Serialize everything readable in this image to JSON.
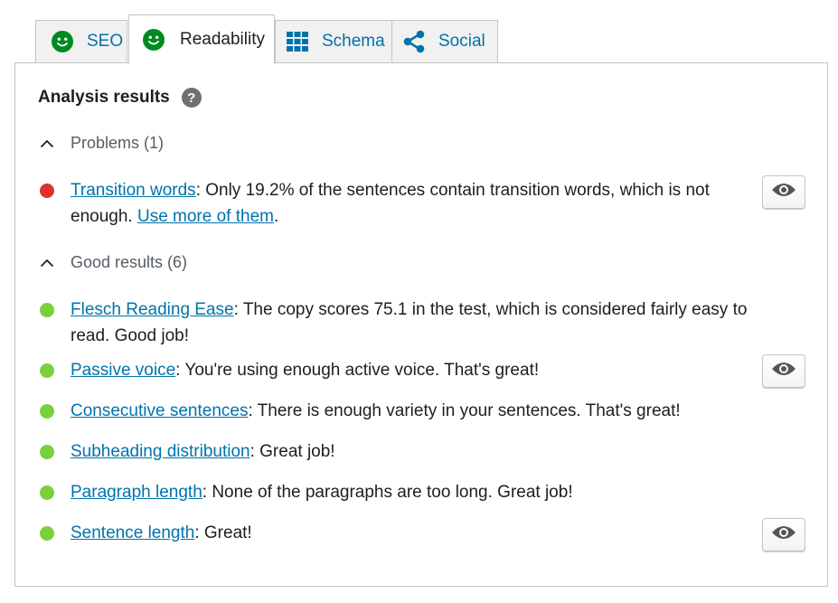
{
  "tabs": {
    "seo": {
      "label": "SEO",
      "icon": "smiley-good-icon",
      "icon_color": "#008a20"
    },
    "readability": {
      "label": "Readability",
      "icon": "smiley-good-icon",
      "icon_color": "#008a20",
      "active": true
    },
    "schema": {
      "label": "Schema",
      "icon": "grid-icon"
    },
    "social": {
      "label": "Social",
      "icon": "share-icon"
    }
  },
  "panel": {
    "heading": "Analysis results",
    "help_icon": "?",
    "problems": {
      "toggle_label": "Problems (1)",
      "items": [
        {
          "link": "Transition words",
          "rest": ": Only 19.2% of the sentences contain transition words, which is not enough. ",
          "link2": "Use more of them",
          "rest2": ".",
          "status": "red",
          "has_eye": true
        }
      ]
    },
    "good": {
      "toggle_label": "Good results (6)",
      "items": [
        {
          "link": "Flesch Reading Ease",
          "rest": ": The copy scores 75.1 in the test, which is considered fairly easy to read. Good job!",
          "status": "green",
          "has_eye": false
        },
        {
          "link": "Passive voice",
          "rest": ": You're using enough active voice. That's great!",
          "status": "green",
          "has_eye": true
        },
        {
          "link": "Consecutive sentences",
          "rest": ": There is enough variety in your sentences. That's great!",
          "status": "green",
          "has_eye": false
        },
        {
          "link": "Subheading distribution",
          "rest": ": Great job!",
          "status": "green",
          "has_eye": false
        },
        {
          "link": "Paragraph length",
          "rest": ": None of the paragraphs are too long. Great job!",
          "status": "green",
          "has_eye": false
        },
        {
          "link": "Sentence length",
          "rest": ": Great!",
          "status": "green",
          "has_eye": true
        }
      ]
    }
  },
  "colors": {
    "link": "#0073aa",
    "problem": "#dc3232",
    "good": "#7ad03a"
  }
}
